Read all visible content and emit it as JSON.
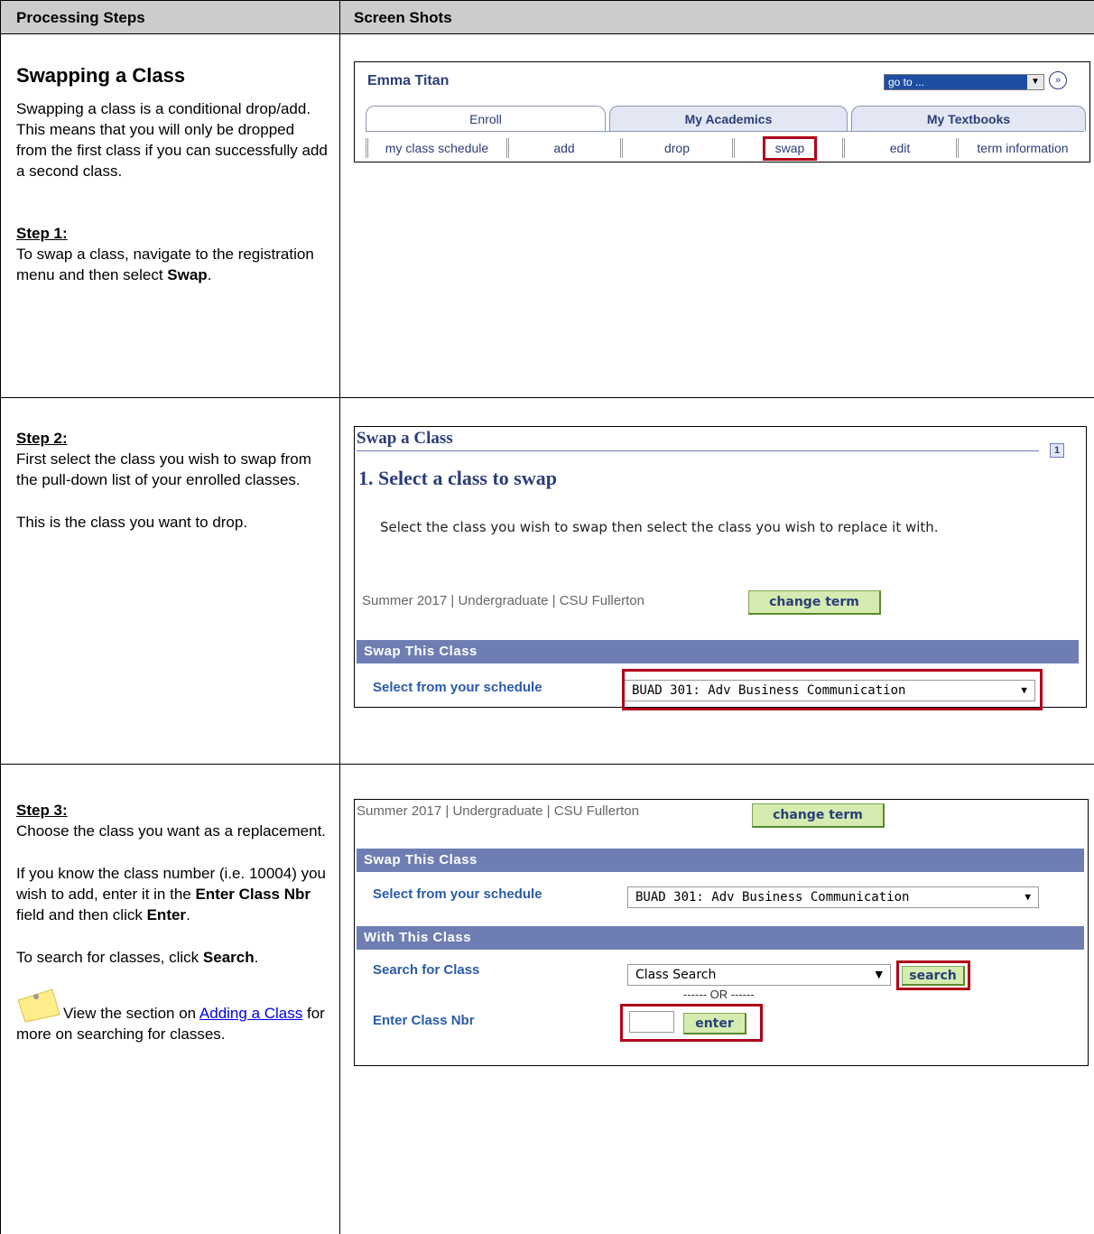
{
  "header": {
    "col_left": "Processing Steps",
    "col_right": "Screen Shots"
  },
  "section1": {
    "title": "Swapping a Class",
    "intro": "Swapping a class is a conditional drop/add. This means that you will only be dropped from the first class if you can successfully add a second class.",
    "step_heading": "Step 1:",
    "step_text_before": "To swap a class, navigate to the registration menu and then select ",
    "step_text_bold": "Swap",
    "step_text_after": "."
  },
  "ss1": {
    "name": "Emma Titan",
    "goto_value": "go to ...",
    "tabs": [
      "Enroll",
      "My Academics",
      "My Textbooks"
    ],
    "subnav": [
      "my class schedule",
      "add",
      "drop",
      "swap",
      "edit",
      "term information"
    ]
  },
  "section2": {
    "step_heading": "Step 2:",
    "para1": "First select the class you wish to swap from the pull-down list of your enrolled classes.",
    "para2": "This is the class you want to drop."
  },
  "ss2": {
    "title": "Swap a Class",
    "page_badge": "1",
    "subtitle": "1.  Select a class to swap",
    "instruction": "Select the class you wish to swap then select the class you wish to replace it with.",
    "term_info": "Summer 2017 | Undergraduate | CSU Fullerton",
    "change_term": "change term",
    "section_bar": "Swap This Class",
    "select_label": "Select from your schedule",
    "select_value": "BUAD 301: Adv Business Communication"
  },
  "section3": {
    "step_heading": "Step 3:",
    "para1": "Choose the class you want as a replacement.",
    "para2_a": "If you know the class number (i.e. 10004) you wish to add, enter it in the ",
    "para2_bold1": "Enter Class Nbr",
    "para2_b": " field and then click ",
    "para2_bold2": "Enter",
    "para2_c": ".",
    "para3_a": "To search for classes, click ",
    "para3_bold": "Search",
    "para3_b": ".",
    "note_a": "View the section on ",
    "note_link": "Adding a Class",
    "note_b": " for more on searching for classes."
  },
  "ss3": {
    "term_info": "Summer 2017 | Undergraduate | CSU Fullerton",
    "change_term": "change term",
    "bar1": "Swap This Class",
    "select_label": "Select from your schedule",
    "select_value": "BUAD 301: Adv Business Communication",
    "bar2": "With This Class",
    "search_label": "Search for Class",
    "search_value": "Class Search",
    "search_button": "search",
    "or_text": "------ OR ------",
    "nbr_label": "Enter Class Nbr",
    "enter_button": "enter"
  }
}
